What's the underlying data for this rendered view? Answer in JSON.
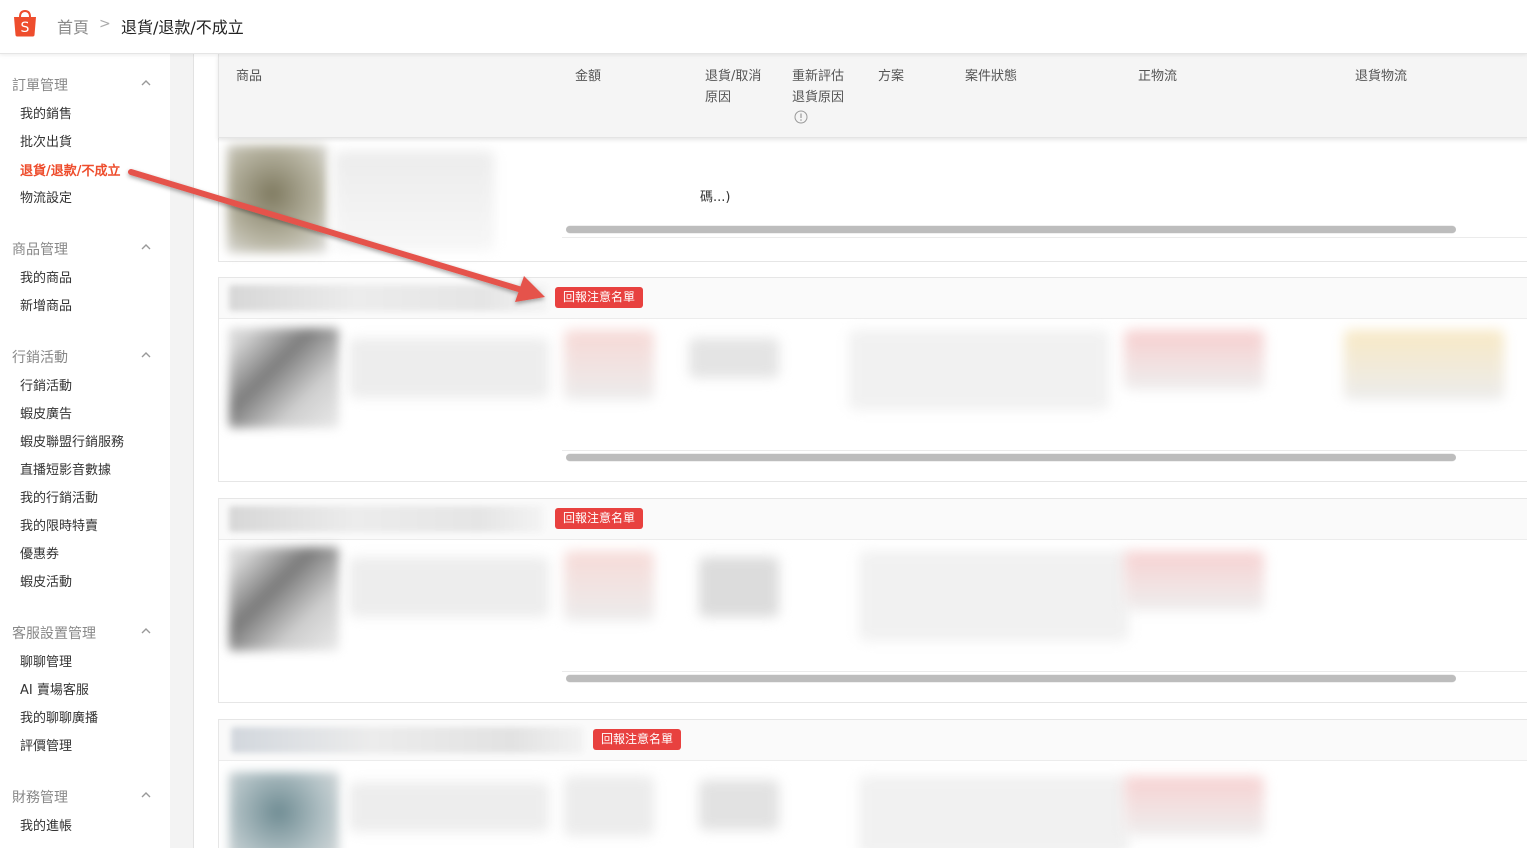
{
  "header": {
    "home_label": "首頁",
    "separator": ">",
    "current_label": "退貨/退款/不成立",
    "logo_letter": "S",
    "brand_color": "#ee4d2d"
  },
  "sidebar": {
    "sections": [
      {
        "title": "訂單管理",
        "items": [
          "我的銷售",
          "批次出貨",
          "退貨/退款/不成立",
          "物流設定"
        ]
      },
      {
        "title": "商品管理",
        "items": [
          "我的商品",
          "新增商品"
        ]
      },
      {
        "title": "行銷活動",
        "items": [
          "行銷活動",
          "蝦皮廣告",
          "蝦皮聯盟行銷服務",
          "直播短影音數據",
          "我的行銷活動",
          "我的限時特賣",
          "優惠券",
          "蝦皮活動"
        ]
      },
      {
        "title": "客服設置管理",
        "items": [
          "聊聊管理",
          "AI 賣場客服",
          "我的聊聊廣播",
          "評價管理"
        ]
      },
      {
        "title": "財務管理",
        "items": [
          "我的進帳"
        ]
      }
    ],
    "active_item": "退貨/退款/不成立"
  },
  "table": {
    "columns": [
      "商品",
      "金額",
      "退貨/取消",
      "原因",
      "重新評估",
      "退貨原因",
      "方案",
      "案件狀態",
      "正物流",
      "退貨物流"
    ],
    "partial_text": "碼...)",
    "info_icon": "info-circle-icon"
  },
  "cards": {
    "badge_label": "回報注意名單",
    "badge_color": "#e8413f"
  },
  "annotation": {
    "arrow_color": "#e5534b",
    "icon": "arrow-annotation-icon"
  }
}
